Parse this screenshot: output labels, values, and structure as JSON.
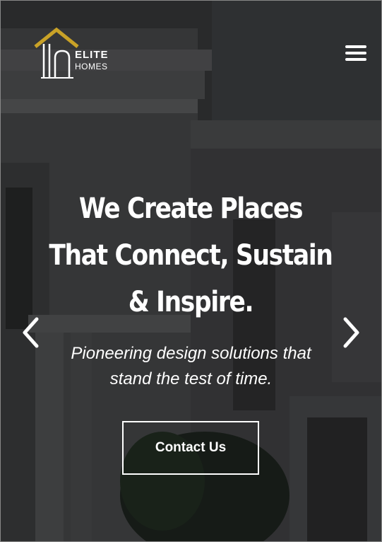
{
  "brand": {
    "name_line1": "ELITE",
    "name_line2": "HOMES",
    "accent_color": "#c9a227"
  },
  "header": {
    "menu_icon": "hamburger-menu-icon"
  },
  "hero": {
    "headline_line1": "We Create Places",
    "headline_line2": "That Connect, Sustain",
    "headline_line3": "& Inspire.",
    "subtitle_line1": "Pioneering design solutions that",
    "subtitle_line2": "stand the test of time.",
    "cta_label": "Contact Us",
    "prev_icon": "chevron-left-icon",
    "next_icon": "chevron-right-icon"
  }
}
